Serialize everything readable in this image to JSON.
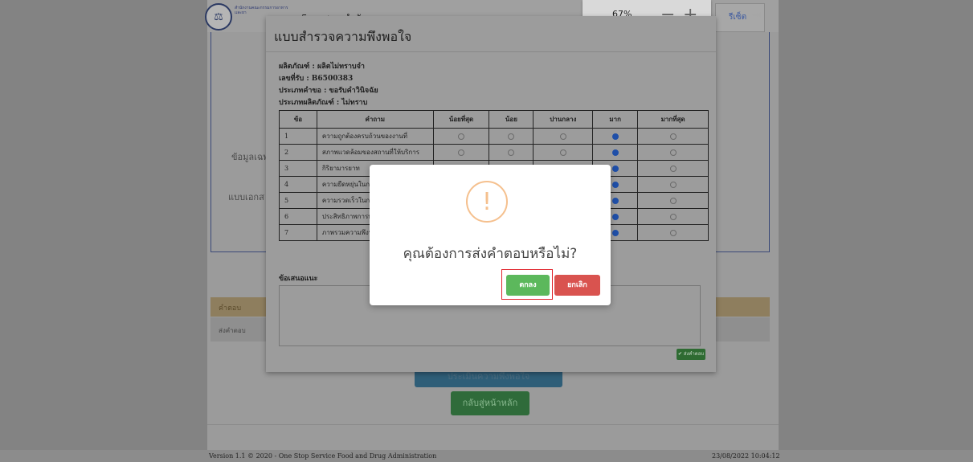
{
  "header": {
    "logo_text": "สำนักงานคณะกรรมการอาหารและยา",
    "title": "5 หดสอบ จำกัด",
    "zoom": "67%",
    "reset_label": "รีเซ็ต"
  },
  "background": {
    "label_info": "ข้อมูลเฉพ",
    "label_docs": "แบบเอกส",
    "answers_header": "คำตอบ",
    "answers_row": "ส่งคำตอบ",
    "eval_button": "ประเมินความพึงพอใจ",
    "home_button": "กลับสู่หน้าหลัก"
  },
  "footer": {
    "version": "Version 1.1 © 2020 - One Stop Service Food and Drug Administration",
    "datetime": "23/08/2022 10:04:12"
  },
  "survey": {
    "title": "แบบสำรวจความพึงพอใจ",
    "product": "ผลิตภัณฑ์ : ผลิตไม่ทราบจำ",
    "receive_no": "เลขที่รับ : B6500383",
    "request_type": "ประเภทคำขอ : ขอรับคำวินิจฉัย",
    "product_type": "ประเภทผลิตภัณฑ์ : ไม่ทราบ",
    "columns": [
      "ข้อ",
      "คำถาม",
      "น้อยที่สุด",
      "น้อย",
      "ปานกลาง",
      "มาก",
      "มากที่สุด"
    ],
    "rows": [
      {
        "no": "1",
        "q": "ความถูกต้องครบถ้วนของงานที่",
        "sel": 3
      },
      {
        "no": "2",
        "q": "สภาพแวดล้อมของสถานที่ให้บริการ",
        "sel": 3
      },
      {
        "no": "3",
        "q": "กิริยามารยาท",
        "sel": 3
      },
      {
        "no": "4",
        "q": "ความยืดหยุ่นในกา",
        "sel": 3
      },
      {
        "no": "5",
        "q": "ความรวดเร็วในกา",
        "sel": 3
      },
      {
        "no": "6",
        "q": "ประสิทธิภาพการท",
        "sel": 3
      },
      {
        "no": "7",
        "q": "ภาพรวมความพึงพ",
        "sel": 3
      }
    ],
    "suggestion_label": "ข้อเสนอแนะ",
    "submit_label": "✔ ส่งคำตอบ"
  },
  "confirm": {
    "message": "คุณต้องการส่งคำตอบหรือไม่?",
    "ok_label": "ตกลง",
    "cancel_label": "ยกเลิก"
  }
}
